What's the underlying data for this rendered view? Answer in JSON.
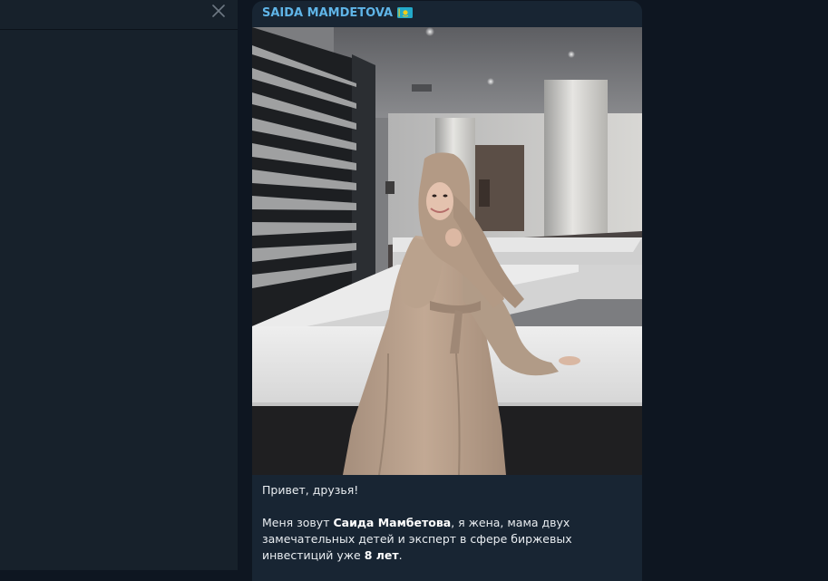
{
  "left_panel": {
    "close_icon": "close-icon"
  },
  "message": {
    "sender": "SAIDA MAMDETOVA",
    "sender_flag": "kazakhstan-flag-icon",
    "photo_subject": "woman-in-beige-abaya-and-hijab",
    "caption": {
      "greeting": "Привет, друзья!",
      "intro_prefix": "Меня зовут ",
      "name": "Саида Мамбетова",
      "intro_mid": ", я жена, мама двух замечательных детей и эксперт в сфере биржевых инвестиций уже ",
      "years": "8 лет",
      "intro_suffix": "."
    }
  },
  "colors": {
    "app_background": "#0e1621",
    "sidebar_background": "#17212b",
    "bubble_background": "#182533",
    "sender_name": "#5fb4e7",
    "text": "#e9edf1"
  }
}
